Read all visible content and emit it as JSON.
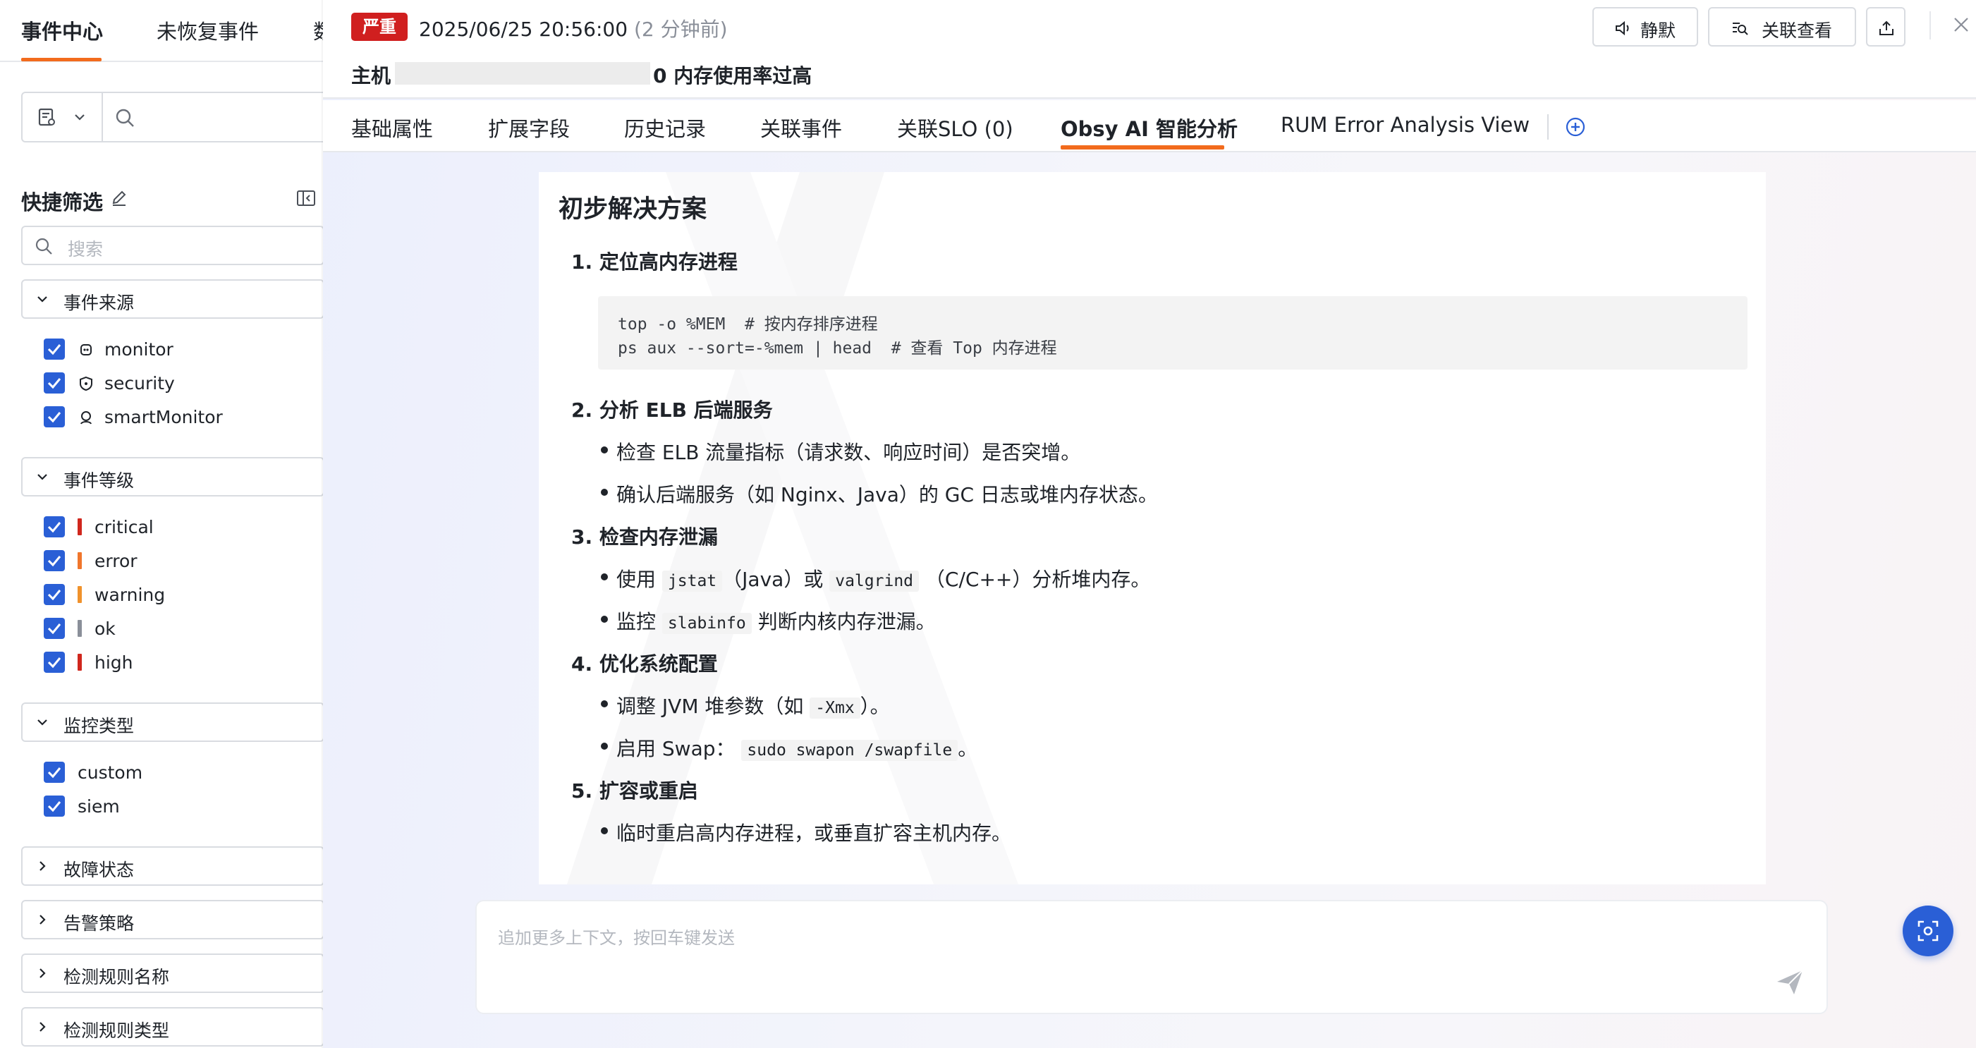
{
  "left_tabs": [
    "事件中心",
    "未恢复事件",
    "数"
  ],
  "quick_filter": {
    "title": "快捷筛选",
    "search_placeholder": "搜索"
  },
  "groups": {
    "source": {
      "label": "事件来源",
      "options": [
        "monitor",
        "security",
        "smartMonitor"
      ]
    },
    "level": {
      "label": "事件等级",
      "options": [
        {
          "label": "critical",
          "color": "#d0271d"
        },
        {
          "label": "error",
          "color": "#f0762c"
        },
        {
          "label": "warning",
          "color": "#f0922c"
        },
        {
          "label": "ok",
          "color": "#8a8f99"
        },
        {
          "label": "high",
          "color": "#d0271d"
        }
      ]
    },
    "monitor_type": {
      "label": "监控类型",
      "options": [
        "custom",
        "siem"
      ]
    },
    "collapsed": [
      "故障状态",
      "告警策略",
      "检测规则名称",
      "检测规则类型"
    ]
  },
  "event": {
    "severity": "严重",
    "timestamp": "2025/06/25 20:56:00",
    "ago": "(2 分钟前)",
    "title_prefix": "主机 c",
    "title_suffix": "0 内存使用率过高"
  },
  "header_buttons": {
    "mute": "静默",
    "related": "关联查看"
  },
  "tabs": [
    "基础属性",
    "扩展字段",
    "历史记录",
    "关联事件",
    "关联SLO (0)",
    "Obsy AI 智能分析",
    "RUM Error Analysis View"
  ],
  "active_tab": "Obsy AI 智能分析",
  "analysis": {
    "heading": "初步解决方案",
    "step1": "1. 定位高内存进程",
    "code_line1": "top -o %MEM  # 按内存排序进程",
    "code_line2": "ps aux --sort=-%mem | head  # 查看 Top 内存进程",
    "step2": "2. 分析 ELB 后端服务",
    "step2_b1": "检查 ELB 流量指标（请求数、响应时间）是否突增。",
    "step2_b2": "确认后端服务（如 Nginx、Java）的 GC 日志或堆内存状态。",
    "step3": "3. 检查内存泄漏",
    "step3_b1_a": "使用",
    "step3_b1_code1": "jstat",
    "step3_b1_b": "（Java）或",
    "step3_b1_code2": "valgrind",
    "step3_b1_c": "（C/C++）分析堆内存。",
    "step3_b2_a": "监控",
    "step3_b2_code": "slabinfo",
    "step3_b2_b": "判断内核内存泄漏。",
    "step4": "4. 优化系统配置",
    "step4_b1_a": "调整 JVM 堆参数（如",
    "step4_b1_code": "-Xmx",
    "step4_b1_b": "）。",
    "step4_b2_a": "启用 Swap：",
    "step4_b2_code": "sudo swapon /swapfile",
    "step4_b2_b": "。",
    "step5": "5. 扩容或重启",
    "step5_b1": "临时重启高内存进程，或垂直扩容主机内存。"
  },
  "chat": {
    "placeholder": "追加更多上下文，按回车键发送"
  },
  "colors": {
    "accent": "#f26b1d",
    "primary": "#2a5fd6",
    "severity": "#d01f1f"
  }
}
